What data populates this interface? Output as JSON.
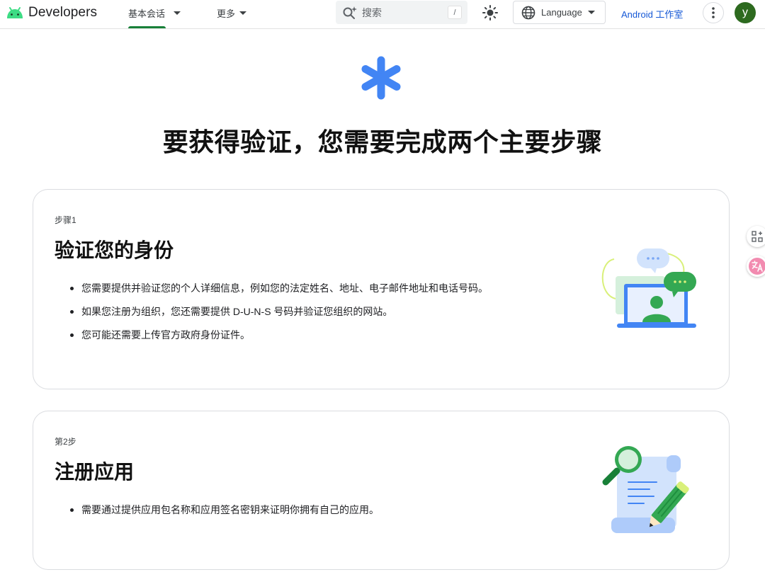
{
  "header": {
    "logo_text": "Developers",
    "nav": [
      {
        "label": "基本会话"
      },
      {
        "label": "更多"
      }
    ],
    "search": {
      "placeholder": "搜索",
      "shortcut": "/"
    },
    "language_label": "Language",
    "studio_link": "Android 工作室",
    "avatar_initial": "y"
  },
  "hero": {
    "title": "要获得验证，您需要完成两个主要步骤"
  },
  "steps": [
    {
      "label": "步骤1",
      "title": "验证您的身份",
      "bullets": [
        "您需要提供并验证您的个人详细信息，例如您的法定姓名、地址、电子邮件地址和电话号码。",
        "如果您注册为组织，您还需要提供 D-U-N-S 号码并验证您组织的网站。",
        "您可能还需要上传官方政府身份证件。"
      ]
    },
    {
      "label": "第2步",
      "title": "注册应用",
      "bullets": [
        "需要通过提供应用包名称和应用签名密钥来证明你拥有自己的应用。"
      ]
    }
  ],
  "colors": {
    "accent_green": "#188038",
    "link_blue": "#1558d6",
    "hero_blue": "#4285f4",
    "avatar_green": "#2d6a1f"
  },
  "icons": [
    "android-logo-icon",
    "search-sparkle-icon",
    "sun-icon",
    "globe-icon",
    "more-vert-icon",
    "asterisk-icon",
    "apps-icon",
    "translate-icon"
  ]
}
